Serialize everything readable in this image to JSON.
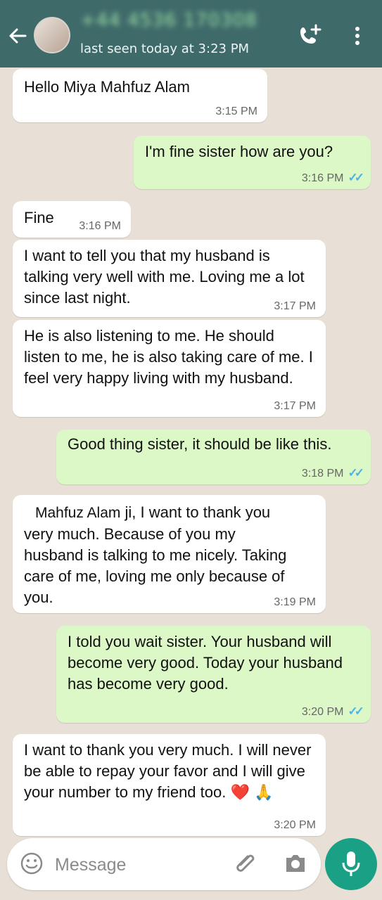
{
  "header": {
    "contact_name": "+44 4536 170308",
    "last_seen": "last seen today at 3:23 PM",
    "icons": [
      "back-arrow-icon",
      "avatar",
      "call-add-icon",
      "menu-dots-icon"
    ]
  },
  "messages": [
    {
      "dir": "in",
      "text": "Hello Miya Mahfuz Alam",
      "time": "3:15 PM"
    },
    {
      "dir": "out",
      "text": "I'm fine sister how are you?",
      "time": "3:16 PM"
    },
    {
      "dir": "in",
      "text": "Fine",
      "time": "3:16 PM"
    },
    {
      "dir": "in",
      "text": "I want to tell you that my husband is talking very well with me. Loving me a lot since last night.",
      "time": "3:17 PM"
    },
    {
      "dir": "in",
      "text": "He is also listening to me. He should listen to me, he is also taking care of me. I feel very happy living with my husband.",
      "time": "3:17 PM"
    },
    {
      "dir": "out",
      "text": "Good thing sister, it should be like this.",
      "time": "3:18 PM"
    },
    {
      "dir": "in",
      "mention": "Mahfuz Alam",
      "text": " ji, I want to thank you very much. Because of you my husband is talking to me nicely. Taking care of me, loving me only because of you.",
      "time": "3:19 PM"
    },
    {
      "dir": "out",
      "text": "I told you wait sister.  Your husband will become very good.  Today your husband has become very good.",
      "time": "3:20 PM"
    },
    {
      "dir": "in",
      "text": "I want to thank you very much. I will never be able to repay your favor and I will give your number to my friend too.",
      "emoji": "❤️ 🙏",
      "time": "3:20 PM"
    }
  ],
  "composer": {
    "placeholder": "Message",
    "icons": [
      "emoji-icon",
      "attach-icon",
      "camera-icon",
      "mic-icon"
    ]
  },
  "colors": {
    "header": "#3f6a6a",
    "incoming": "#ffffff",
    "outgoing": "#dcf8c6",
    "tick": "#4fb3ea",
    "mic": "#1aa085"
  }
}
